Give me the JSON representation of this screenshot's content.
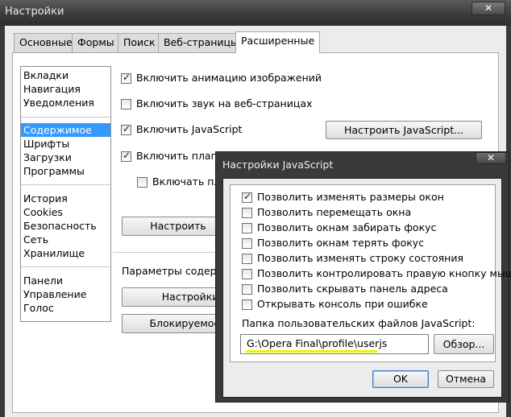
{
  "window": {
    "title": "Настройки",
    "close_glyph": "✕"
  },
  "tabs": [
    {
      "label": "Основные"
    },
    {
      "label": "Формы"
    },
    {
      "label": "Поиск"
    },
    {
      "label": "Веб-страницы"
    },
    {
      "label": "Расширенные",
      "active": true
    }
  ],
  "sidebar": {
    "groups": [
      [
        "Вкладки",
        "Навигация",
        "Уведомления"
      ],
      [
        "Содержимое",
        "Шрифты",
        "Загрузки",
        "Программы"
      ],
      [
        "История",
        "Cookies",
        "Безопасность",
        "Сеть",
        "Хранилище"
      ],
      [
        "Панели",
        "Управление",
        "Голос"
      ]
    ],
    "selected": "Содержимое"
  },
  "content": {
    "animate_images": {
      "label": "Включить анимацию изображений",
      "checked": true
    },
    "web_sounds": {
      "label": "Включить звук на веб-страницах",
      "checked": false
    },
    "javascript": {
      "label": "Включить JavaScript",
      "checked": true
    },
    "javascript_button": "Настроить JavaScript...",
    "plugins": {
      "label": "Включить плагин",
      "checked": true
    },
    "plugins_sub": {
      "label": "Включать пла",
      "checked": false
    },
    "configure_button": "Настроить",
    "content_params_label": "Параметры содерж",
    "settings_button": "Настройки д",
    "blocked_button": "Блокируемое с"
  },
  "js_dialog": {
    "title": "Настройки JavaScript",
    "close_glyph": "✕",
    "options": [
      {
        "label": "Позволить изменять размеры окон",
        "checked": true
      },
      {
        "label": "Позволить перемещать окна",
        "checked": false
      },
      {
        "label": "Позволить окнам забирать фокус",
        "checked": false
      },
      {
        "label": "Позволить окнам терять фокус",
        "checked": false
      },
      {
        "label": "Позволить изменять строку состояния",
        "checked": false
      },
      {
        "label": "Позволить контролировать правую кнопку мыши",
        "checked": false
      },
      {
        "label": "Позволить скрывать панель адреса",
        "checked": false
      },
      {
        "label": "Открывать консоль при ошибке",
        "checked": false
      }
    ],
    "folder_label": "Папка пользовательских файлов JavaScript:",
    "folder_value": "G:\\Opera Final\\profile\\userjs",
    "browse_button": "Обзор...",
    "ok_button": "OK",
    "cancel_button": "Отмена"
  }
}
